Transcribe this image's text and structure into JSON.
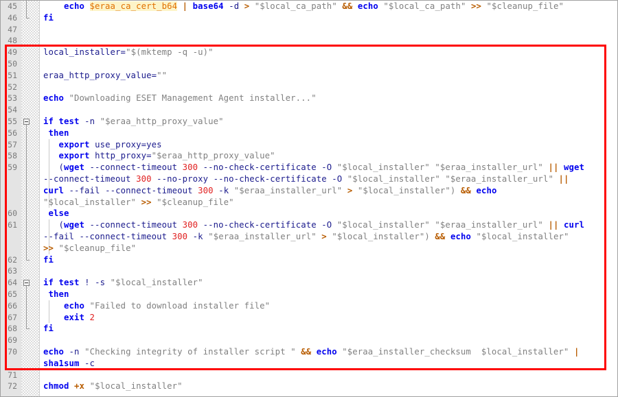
{
  "editor": {
    "kind": "code-editor",
    "language": "shell",
    "first_line": 45,
    "last_line": 72,
    "line_height_px": 16.8,
    "colors": {
      "background": "#ffffff",
      "gutter": "#e4e4e4",
      "line_number": "#7a7a7a",
      "keyword": "#0000ee",
      "string": "#808080",
      "number": "#e02020",
      "operator": "#b85c00",
      "variable": "#1a1a8c",
      "highlight_text": "#e07000",
      "highlight_background": "#fdf4c8",
      "annotation_box": "#fe0000"
    },
    "annotation": {
      "name": "red-highlight-box",
      "color": "#fe0000",
      "starts_at_line": 49,
      "ends_at_line": 70
    }
  },
  "lines": [
    {
      "n": "45",
      "fold": "vline",
      "indent": [],
      "tokens": [
        {
          "t": "    ",
          "c": "pl"
        },
        {
          "t": "echo",
          "c": "cmd"
        },
        {
          "t": " ",
          "c": "pl"
        },
        {
          "t": "$eraa_ca_cert_b64",
          "c": "hl"
        },
        {
          "t": " ",
          "c": "pl"
        },
        {
          "t": "|",
          "c": "op"
        },
        {
          "t": " ",
          "c": "pl"
        },
        {
          "t": "base64",
          "c": "cmd"
        },
        {
          "t": " ",
          "c": "pl"
        },
        {
          "t": "-d",
          "c": "var"
        },
        {
          "t": " ",
          "c": "pl"
        },
        {
          "t": ">",
          "c": "op"
        },
        {
          "t": " ",
          "c": "pl"
        },
        {
          "t": "\"$local_ca_path\"",
          "c": "str"
        },
        {
          "t": " ",
          "c": "pl"
        },
        {
          "t": "&&",
          "c": "op"
        },
        {
          "t": " ",
          "c": "pl"
        },
        {
          "t": "echo",
          "c": "cmd"
        },
        {
          "t": " ",
          "c": "pl"
        },
        {
          "t": "\"$local_ca_path\"",
          "c": "str"
        },
        {
          "t": " ",
          "c": "pl"
        },
        {
          "t": ">>",
          "c": "op"
        },
        {
          "t": " ",
          "c": "pl"
        },
        {
          "t": "\"$cleanup_file\"",
          "c": "str"
        }
      ]
    },
    {
      "n": "46",
      "fold": "end",
      "indent": [],
      "tokens": [
        {
          "t": "fi",
          "c": "kw"
        }
      ]
    },
    {
      "n": "47",
      "fold": "none",
      "indent": [],
      "tokens": []
    },
    {
      "n": "48",
      "fold": "none",
      "indent": [],
      "tokens": []
    },
    {
      "n": "49",
      "fold": "none",
      "indent": [],
      "tokens": [
        {
          "t": "local_installer=",
          "c": "var"
        },
        {
          "t": "\"$(mktemp -q -u)\"",
          "c": "str"
        }
      ]
    },
    {
      "n": "50",
      "fold": "none",
      "indent": [],
      "tokens": []
    },
    {
      "n": "51",
      "fold": "none",
      "indent": [],
      "tokens": [
        {
          "t": "eraa_http_proxy_value=",
          "c": "var"
        },
        {
          "t": "\"\"",
          "c": "str"
        }
      ]
    },
    {
      "n": "52",
      "fold": "none",
      "indent": [],
      "tokens": []
    },
    {
      "n": "53",
      "fold": "none",
      "indent": [],
      "tokens": [
        {
          "t": "echo",
          "c": "cmd"
        },
        {
          "t": " ",
          "c": "pl"
        },
        {
          "t": "\"Downloading ESET Management Agent installer...\"",
          "c": "str"
        }
      ]
    },
    {
      "n": "54",
      "fold": "none",
      "indent": [],
      "tokens": []
    },
    {
      "n": "55",
      "fold": "box",
      "indent": [],
      "tokens": [
        {
          "t": "if",
          "c": "kw"
        },
        {
          "t": " ",
          "c": "pl"
        },
        {
          "t": "test",
          "c": "cmd"
        },
        {
          "t": " ",
          "c": "pl"
        },
        {
          "t": "-n",
          "c": "var"
        },
        {
          "t": " ",
          "c": "pl"
        },
        {
          "t": "\"$eraa_http_proxy_value\"",
          "c": "str"
        }
      ]
    },
    {
      "n": "56",
      "fold": "vline",
      "indent": [],
      "tokens": [
        {
          "t": " ",
          "c": "pl"
        },
        {
          "t": "then",
          "c": "kw"
        }
      ]
    },
    {
      "n": "57",
      "fold": "vline",
      "indent": [
        70
      ],
      "tokens": [
        {
          "t": "   ",
          "c": "pl"
        },
        {
          "t": "export",
          "c": "kw"
        },
        {
          "t": " ",
          "c": "pl"
        },
        {
          "t": "use_proxy=yes",
          "c": "var"
        }
      ]
    },
    {
      "n": "58",
      "fold": "vline",
      "indent": [
        70
      ],
      "tokens": [
        {
          "t": "   ",
          "c": "pl"
        },
        {
          "t": "export",
          "c": "kw"
        },
        {
          "t": " ",
          "c": "pl"
        },
        {
          "t": "http_proxy=",
          "c": "var"
        },
        {
          "t": "\"$eraa_http_proxy_value\"",
          "c": "str"
        }
      ]
    },
    {
      "n": "59",
      "fold": "vline",
      "indent": [
        70
      ],
      "tokens": [
        {
          "t": "   (",
          "c": "pl"
        },
        {
          "t": "wget",
          "c": "cmd"
        },
        {
          "t": " ",
          "c": "pl"
        },
        {
          "t": "--connect-timeout",
          "c": "var"
        },
        {
          "t": " ",
          "c": "pl"
        },
        {
          "t": "300",
          "c": "num"
        },
        {
          "t": " ",
          "c": "pl"
        },
        {
          "t": "--no-check-certificate",
          "c": "var"
        },
        {
          "t": " ",
          "c": "pl"
        },
        {
          "t": "-O",
          "c": "var"
        },
        {
          "t": " ",
          "c": "pl"
        },
        {
          "t": "\"$local_installer\"",
          "c": "str"
        },
        {
          "t": " ",
          "c": "pl"
        },
        {
          "t": "\"$eraa_installer_url\"",
          "c": "str"
        },
        {
          "t": " ",
          "c": "pl"
        },
        {
          "t": "||",
          "c": "op"
        },
        {
          "t": " ",
          "c": "pl"
        },
        {
          "t": "wget",
          "c": "cmd"
        }
      ]
    },
    {
      "n": "59b",
      "cont": true,
      "fold": "vline",
      "indent": [
        70
      ],
      "tokens": [
        {
          "t": "--connect-timeout",
          "c": "var"
        },
        {
          "t": " ",
          "c": "pl"
        },
        {
          "t": "300",
          "c": "num"
        },
        {
          "t": " ",
          "c": "pl"
        },
        {
          "t": "--no-proxy",
          "c": "var"
        },
        {
          "t": " ",
          "c": "pl"
        },
        {
          "t": "--no-check-certificate",
          "c": "var"
        },
        {
          "t": " ",
          "c": "pl"
        },
        {
          "t": "-O",
          "c": "var"
        },
        {
          "t": " ",
          "c": "pl"
        },
        {
          "t": "\"$local_installer\"",
          "c": "str"
        },
        {
          "t": " ",
          "c": "pl"
        },
        {
          "t": "\"$eraa_installer_url\"",
          "c": "str"
        },
        {
          "t": " ",
          "c": "pl"
        },
        {
          "t": "||",
          "c": "op"
        }
      ]
    },
    {
      "n": "59c",
      "cont": true,
      "fold": "vline",
      "indent": [
        70
      ],
      "tokens": [
        {
          "t": "curl",
          "c": "cmd"
        },
        {
          "t": " ",
          "c": "pl"
        },
        {
          "t": "--fail",
          "c": "var"
        },
        {
          "t": " ",
          "c": "pl"
        },
        {
          "t": "--connect-timeout",
          "c": "var"
        },
        {
          "t": " ",
          "c": "pl"
        },
        {
          "t": "300",
          "c": "num"
        },
        {
          "t": " ",
          "c": "pl"
        },
        {
          "t": "-k",
          "c": "var"
        },
        {
          "t": " ",
          "c": "pl"
        },
        {
          "t": "\"$eraa_installer_url\"",
          "c": "str"
        },
        {
          "t": " ",
          "c": "pl"
        },
        {
          "t": ">",
          "c": "op"
        },
        {
          "t": " ",
          "c": "pl"
        },
        {
          "t": "\"$local_installer\")",
          "c": "str"
        },
        {
          "t": " ",
          "c": "pl"
        },
        {
          "t": "&&",
          "c": "op"
        },
        {
          "t": " ",
          "c": "pl"
        },
        {
          "t": "echo",
          "c": "cmd"
        }
      ]
    },
    {
      "n": "59d",
      "cont": true,
      "fold": "vline",
      "indent": [
        70
      ],
      "tokens": [
        {
          "t": "\"$local_installer\"",
          "c": "str"
        },
        {
          "t": " ",
          "c": "pl"
        },
        {
          "t": ">>",
          "c": "op"
        },
        {
          "t": " ",
          "c": "pl"
        },
        {
          "t": "\"$cleanup_file\"",
          "c": "str"
        }
      ]
    },
    {
      "n": "60",
      "fold": "vline",
      "indent": [],
      "tokens": [
        {
          "t": " ",
          "c": "pl"
        },
        {
          "t": "else",
          "c": "kw"
        }
      ]
    },
    {
      "n": "61",
      "fold": "vline",
      "indent": [
        70
      ],
      "tokens": [
        {
          "t": "   (",
          "c": "pl"
        },
        {
          "t": "wget",
          "c": "cmd"
        },
        {
          "t": " ",
          "c": "pl"
        },
        {
          "t": "--connect-timeout",
          "c": "var"
        },
        {
          "t": " ",
          "c": "pl"
        },
        {
          "t": "300",
          "c": "num"
        },
        {
          "t": " ",
          "c": "pl"
        },
        {
          "t": "--no-check-certificate",
          "c": "var"
        },
        {
          "t": " ",
          "c": "pl"
        },
        {
          "t": "-O",
          "c": "var"
        },
        {
          "t": " ",
          "c": "pl"
        },
        {
          "t": "\"$local_installer\"",
          "c": "str"
        },
        {
          "t": " ",
          "c": "pl"
        },
        {
          "t": "\"$eraa_installer_url\"",
          "c": "str"
        },
        {
          "t": " ",
          "c": "pl"
        },
        {
          "t": "||",
          "c": "op"
        },
        {
          "t": " ",
          "c": "pl"
        },
        {
          "t": "curl",
          "c": "cmd"
        }
      ]
    },
    {
      "n": "61b",
      "cont": true,
      "fold": "vline",
      "indent": [
        70
      ],
      "tokens": [
        {
          "t": "--fail",
          "c": "var"
        },
        {
          "t": " ",
          "c": "pl"
        },
        {
          "t": "--connect-timeout",
          "c": "var"
        },
        {
          "t": " ",
          "c": "pl"
        },
        {
          "t": "300",
          "c": "num"
        },
        {
          "t": " ",
          "c": "pl"
        },
        {
          "t": "-k",
          "c": "var"
        },
        {
          "t": " ",
          "c": "pl"
        },
        {
          "t": "\"$eraa_installer_url\"",
          "c": "str"
        },
        {
          "t": " ",
          "c": "pl"
        },
        {
          "t": ">",
          "c": "op"
        },
        {
          "t": " ",
          "c": "pl"
        },
        {
          "t": "\"$local_installer\")",
          "c": "str"
        },
        {
          "t": " ",
          "c": "pl"
        },
        {
          "t": "&&",
          "c": "op"
        },
        {
          "t": " ",
          "c": "pl"
        },
        {
          "t": "echo",
          "c": "cmd"
        },
        {
          "t": " ",
          "c": "pl"
        },
        {
          "t": "\"$local_installer\"",
          "c": "str"
        }
      ]
    },
    {
      "n": "61c",
      "cont": true,
      "fold": "vline",
      "indent": [
        70
      ],
      "tokens": [
        {
          "t": ">>",
          "c": "op"
        },
        {
          "t": " ",
          "c": "pl"
        },
        {
          "t": "\"$cleanup_file\"",
          "c": "str"
        }
      ]
    },
    {
      "n": "62",
      "fold": "end",
      "indent": [],
      "tokens": [
        {
          "t": "fi",
          "c": "kw"
        }
      ]
    },
    {
      "n": "63",
      "fold": "none",
      "indent": [],
      "tokens": []
    },
    {
      "n": "64",
      "fold": "box",
      "indent": [],
      "tokens": [
        {
          "t": "if",
          "c": "kw"
        },
        {
          "t": " ",
          "c": "pl"
        },
        {
          "t": "test",
          "c": "cmd"
        },
        {
          "t": " ",
          "c": "pl"
        },
        {
          "t": "!",
          "c": "var"
        },
        {
          "t": " ",
          "c": "pl"
        },
        {
          "t": "-s",
          "c": "var"
        },
        {
          "t": " ",
          "c": "pl"
        },
        {
          "t": "\"$local_installer\"",
          "c": "str"
        }
      ]
    },
    {
      "n": "65",
      "fold": "vline",
      "indent": [],
      "tokens": [
        {
          "t": " ",
          "c": "pl"
        },
        {
          "t": "then",
          "c": "kw"
        }
      ]
    },
    {
      "n": "66",
      "fold": "vline",
      "indent": [
        70
      ],
      "tokens": [
        {
          "t": "    ",
          "c": "pl"
        },
        {
          "t": "echo",
          "c": "cmd"
        },
        {
          "t": " ",
          "c": "pl"
        },
        {
          "t": "\"Failed to download installer file\"",
          "c": "str"
        }
      ]
    },
    {
      "n": "67",
      "fold": "vline",
      "indent": [
        70
      ],
      "tokens": [
        {
          "t": "    ",
          "c": "pl"
        },
        {
          "t": "exit",
          "c": "kw"
        },
        {
          "t": " ",
          "c": "pl"
        },
        {
          "t": "2",
          "c": "num"
        }
      ]
    },
    {
      "n": "68",
      "fold": "end",
      "indent": [],
      "tokens": [
        {
          "t": "fi",
          "c": "kw"
        }
      ]
    },
    {
      "n": "69",
      "fold": "none",
      "indent": [],
      "tokens": []
    },
    {
      "n": "70",
      "fold": "none",
      "indent": [],
      "tokens": [
        {
          "t": "echo",
          "c": "cmd"
        },
        {
          "t": " ",
          "c": "pl"
        },
        {
          "t": "-n",
          "c": "var"
        },
        {
          "t": " ",
          "c": "pl"
        },
        {
          "t": "\"Checking integrity of installer script \"",
          "c": "str"
        },
        {
          "t": " ",
          "c": "pl"
        },
        {
          "t": "&&",
          "c": "op"
        },
        {
          "t": " ",
          "c": "pl"
        },
        {
          "t": "echo",
          "c": "cmd"
        },
        {
          "t": " ",
          "c": "pl"
        },
        {
          "t": "\"$eraa_installer_checksum  $local_installer\"",
          "c": "str"
        },
        {
          "t": " ",
          "c": "pl"
        },
        {
          "t": "|",
          "c": "op"
        }
      ]
    },
    {
      "n": "70b",
      "cont": true,
      "fold": "none",
      "indent": [],
      "tokens": [
        {
          "t": "sha1sum",
          "c": "cmd"
        },
        {
          "t": " ",
          "c": "pl"
        },
        {
          "t": "-c",
          "c": "var"
        }
      ]
    },
    {
      "n": "71",
      "fold": "none",
      "indent": [],
      "tokens": []
    },
    {
      "n": "72",
      "fold": "none",
      "indent": [],
      "tokens": [
        {
          "t": "chmod",
          "c": "cmd"
        },
        {
          "t": " ",
          "c": "pl"
        },
        {
          "t": "+x",
          "c": "op"
        },
        {
          "t": " ",
          "c": "pl"
        },
        {
          "t": "\"$local_installer\"",
          "c": "str"
        }
      ]
    }
  ]
}
